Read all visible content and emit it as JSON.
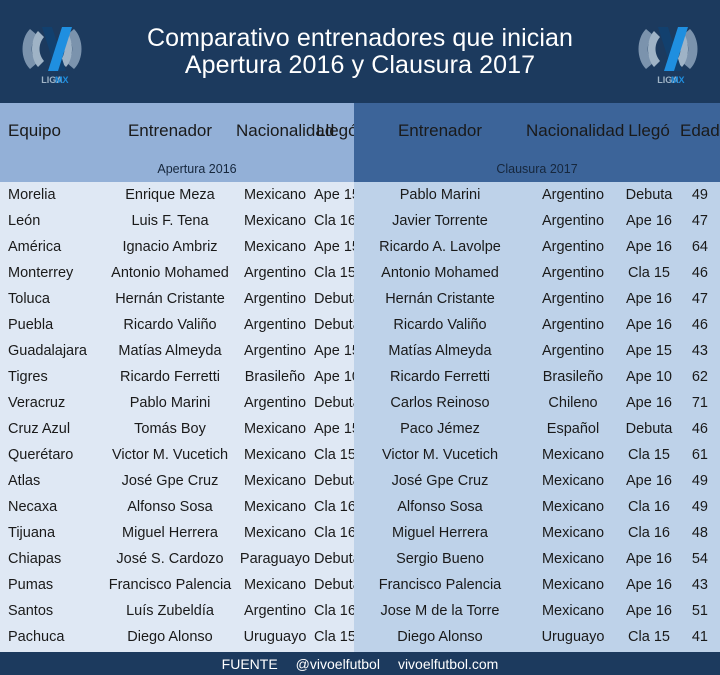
{
  "banner": {
    "title_line1": "Comparativo entrenadores que inician",
    "title_line2": "Apertura 2016 y Clausura 2017",
    "logo_left_name": "liga-mx-logo",
    "logo_right_name": "liga-mx-logo",
    "logo_text": "LIGA MX",
    "bg_color": "#1c3a5e"
  },
  "left_panel": {
    "subtitle": "Apertura 2016",
    "bg_header": "#93b0d7",
    "bg_body": "#dfe8f4",
    "columns": [
      "Equipo",
      "Entrenador",
      "Nacionalidad",
      "Llegó"
    ]
  },
  "right_panel": {
    "subtitle": "Clausura 2017",
    "bg_header": "#3c6499",
    "bg_body": "#bed2e9",
    "columns": [
      "Entrenador",
      "Nacionalidad",
      "Llegó",
      "Edad"
    ]
  },
  "rows": [
    {
      "equipo": "Morelia",
      "a_entrenador": "Enrique Meza",
      "a_nacionalidad": "Mexicano",
      "a_llego": "Ape 15",
      "c_entrenador": "Pablo Marini",
      "c_nacionalidad": "Argentino",
      "c_llego": "Debuta",
      "c_edad": "49"
    },
    {
      "equipo": "León",
      "a_entrenador": "Luis F. Tena",
      "a_nacionalidad": "Mexicano",
      "a_llego": "Cla 16",
      "c_entrenador": "Javier Torrente",
      "c_nacionalidad": "Argentino",
      "c_llego": "Ape 16",
      "c_edad": "47"
    },
    {
      "equipo": "América",
      "a_entrenador": "Ignacio Ambriz",
      "a_nacionalidad": "Mexicano",
      "a_llego": "Ape 15",
      "c_entrenador": "Ricardo A. Lavolpe",
      "c_nacionalidad": "Argentino",
      "c_llego": "Ape 16",
      "c_edad": "64"
    },
    {
      "equipo": "Monterrey",
      "a_entrenador": "Antonio Mohamed",
      "a_nacionalidad": "Argentino",
      "a_llego": "Cla 15",
      "c_entrenador": "Antonio Mohamed",
      "c_nacionalidad": "Argentino",
      "c_llego": "Cla 15",
      "c_edad": "46"
    },
    {
      "equipo": "Toluca",
      "a_entrenador": "Hernán Cristante",
      "a_nacionalidad": "Argentino",
      "a_llego": "Debuta",
      "c_entrenador": "Hernán Cristante",
      "c_nacionalidad": "Argentino",
      "c_llego": "Ape 16",
      "c_edad": "47"
    },
    {
      "equipo": "Puebla",
      "a_entrenador": "Ricardo Valiño",
      "a_nacionalidad": "Argentino",
      "a_llego": "Debuta",
      "c_entrenador": "Ricardo Valiño",
      "c_nacionalidad": "Argentino",
      "c_llego": "Ape 16",
      "c_edad": "46"
    },
    {
      "equipo": "Guadalajara",
      "a_entrenador": "Matías Almeyda",
      "a_nacionalidad": "Argentino",
      "a_llego": "Ape 15",
      "c_entrenador": "Matías Almeyda",
      "c_nacionalidad": "Argentino",
      "c_llego": "Ape 15",
      "c_edad": "43"
    },
    {
      "equipo": "Tigres",
      "a_entrenador": "Ricardo Ferretti",
      "a_nacionalidad": "Brasileño",
      "a_llego": "Ape 10",
      "c_entrenador": "Ricardo Ferretti",
      "c_nacionalidad": "Brasileño",
      "c_llego": "Ape 10",
      "c_edad": "62"
    },
    {
      "equipo": "Veracruz",
      "a_entrenador": "Pablo Marini",
      "a_nacionalidad": "Argentino",
      "a_llego": "Debuta",
      "c_entrenador": "Carlos Reinoso",
      "c_nacionalidad": "Chileno",
      "c_llego": "Ape 16",
      "c_edad": "71"
    },
    {
      "equipo": "Cruz Azul",
      "a_entrenador": "Tomás Boy",
      "a_nacionalidad": "Mexicano",
      "a_llego": "Ape 15",
      "c_entrenador": "Paco Jémez",
      "c_nacionalidad": "Español",
      "c_llego": "Debuta",
      "c_edad": "46"
    },
    {
      "equipo": "Querétaro",
      "a_entrenador": "Victor M. Vucetich",
      "a_nacionalidad": "Mexicano",
      "a_llego": "Cla 15",
      "c_entrenador": "Victor M. Vucetich",
      "c_nacionalidad": "Mexicano",
      "c_llego": "Cla 15",
      "c_edad": "61"
    },
    {
      "equipo": "Atlas",
      "a_entrenador": "José Gpe Cruz",
      "a_nacionalidad": "Mexicano",
      "a_llego": "Debuta",
      "c_entrenador": "José Gpe Cruz",
      "c_nacionalidad": "Mexicano",
      "c_llego": "Ape 16",
      "c_edad": "49"
    },
    {
      "equipo": "Necaxa",
      "a_entrenador": "Alfonso Sosa",
      "a_nacionalidad": "Mexicano",
      "a_llego": "Cla 16",
      "c_entrenador": "Alfonso Sosa",
      "c_nacionalidad": "Mexicano",
      "c_llego": "Cla 16",
      "c_edad": "49"
    },
    {
      "equipo": "Tijuana",
      "a_entrenador": "Miguel Herrera",
      "a_nacionalidad": "Mexicano",
      "a_llego": "Cla 16",
      "c_entrenador": "Miguel Herrera",
      "c_nacionalidad": "Mexicano",
      "c_llego": "Cla 16",
      "c_edad": "48"
    },
    {
      "equipo": "Chiapas",
      "a_entrenador": "José S. Cardozo",
      "a_nacionalidad": "Paraguayo",
      "a_llego": "Debuta",
      "c_entrenador": "Sergio Bueno",
      "c_nacionalidad": "Mexicano",
      "c_llego": "Ape 16",
      "c_edad": "54"
    },
    {
      "equipo": "Pumas",
      "a_entrenador": "Francisco Palencia",
      "a_nacionalidad": "Mexicano",
      "a_llego": "Debuta",
      "c_entrenador": "Francisco Palencia",
      "c_nacionalidad": "Mexicano",
      "c_llego": "Ape 16",
      "c_edad": "43"
    },
    {
      "equipo": "Santos",
      "a_entrenador": "Luís Zubeldía",
      "a_nacionalidad": "Argentino",
      "a_llego": "Cla 16",
      "c_entrenador": "Jose M de la Torre",
      "c_nacionalidad": "Mexicano",
      "c_llego": "Ape 16",
      "c_edad": "51"
    },
    {
      "equipo": "Pachuca",
      "a_entrenador": "Diego Alonso",
      "a_nacionalidad": "Uruguayo",
      "a_llego": "Cla 15",
      "c_entrenador": "Diego Alonso",
      "c_nacionalidad": "Uruguayo",
      "c_llego": "Cla 15",
      "c_edad": "41"
    }
  ],
  "footer": {
    "label": "FUENTE",
    "handle": "@vivoelfutbol",
    "site": "vivoelfutbol.com",
    "bg_color": "#1c3a5e"
  }
}
